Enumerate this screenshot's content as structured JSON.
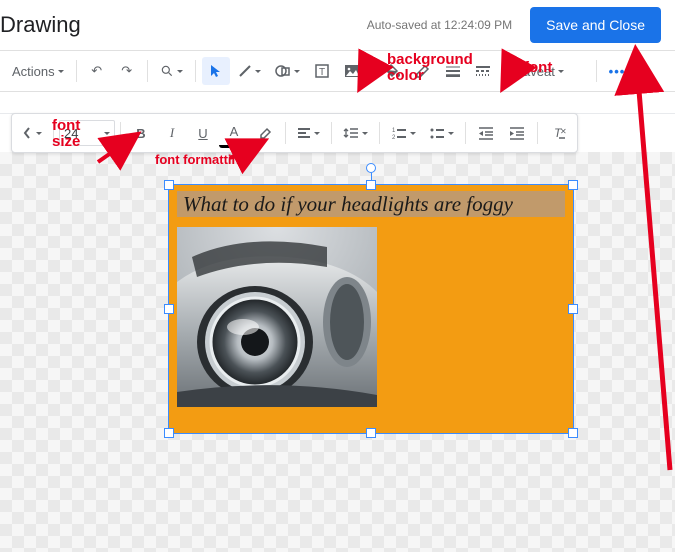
{
  "header": {
    "title": "Drawing",
    "autosave": "Auto-saved at 12:24:09 PM",
    "save_label": "Save and Close"
  },
  "toolbar": {
    "actions": "Actions",
    "font_name": "Caveat",
    "more": "•••"
  },
  "text_toolbar": {
    "font_size": "24",
    "bold": "B",
    "italic": "I",
    "underline": "U",
    "textcolor": "A"
  },
  "canvas": {
    "caption": "What to do if your headlights are foggy"
  },
  "annotations": {
    "bg_color": "background\ncolor",
    "font": "font",
    "font_size": "font\nsize",
    "font_formatting": "font formatting"
  }
}
